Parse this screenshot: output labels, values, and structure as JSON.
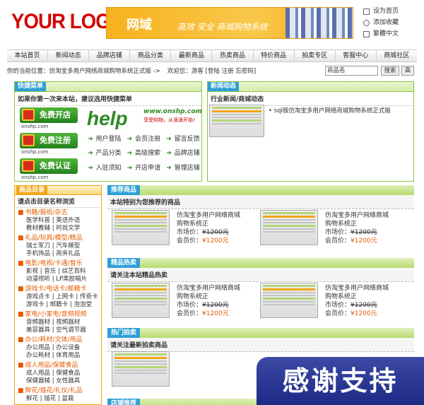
{
  "header": {
    "logo": "YOUR LOGO",
    "banner_title": "网域",
    "banner_slogan": "高效 安全 商城购物系统",
    "top_links": [
      "设为首页",
      "添加收藏",
      "繁體中文"
    ]
  },
  "nav": [
    "本站首页",
    "新闻动态",
    "品牌店铺",
    "商品分类",
    "最新商品",
    "热卖商品",
    "特价商品",
    "拍卖专区",
    "客服中心",
    "商城社区"
  ],
  "location": {
    "text": "你的当前位置：仿淘宝多用户网络商城购物系统正式版 ->",
    "welcome": "欢迎您：游客 [登陆 注册 忘密码]"
  },
  "search": {
    "value": "商品名",
    "button": "搜索",
    "button2": "高"
  },
  "quick": {
    "tab": "快捷菜单",
    "subtitle": "如果你第一次来本站，建议选用快捷菜单",
    "buttons": [
      "免费开店",
      "免费注册",
      "免费认证"
    ],
    "site": "onshp.com",
    "help": "help",
    "help_url": "www.onshp.com",
    "help_slogan": "享受购物，从滴滴开始!",
    "links": [
      [
        "用户登陆",
        "会员注册",
        "留言反馈"
      ],
      [
        "产品分类",
        "高级搜索",
        "品牌店铺"
      ],
      [
        "入驻须知",
        "开店申请",
        "管理店铺"
      ]
    ]
  },
  "news": {
    "tab": "新闻动态",
    "subtitle": "行业新闻/商城动态",
    "items": [
      "sql版仿淘宝多用户网络商城购物系统正式版"
    ]
  },
  "catalog": {
    "tab": "商品目录",
    "subtitle": "请点击目录名称浏览",
    "groups": [
      {
        "head": "书籍/报纸/杂志",
        "items": [
          "医学科普 | 英语外语",
          "教材教辅 | 时尚文学"
        ]
      },
      {
        "head": "礼品/玩具/模型/精品",
        "items": [
          "瑞士军刀 | 汽车模型",
          "手机饰品 | 商务礼品"
        ]
      },
      {
        "head": "电影/电视/卡通/音乐",
        "items": [
          "影视 | 音乐 | 综艺百科",
          "动漫视听 | LP黑胶唱片"
        ]
      },
      {
        "head": "游戏卡/电话卡/邮籍卡",
        "items": [
          "游戏点卡 | 上网卡 | 传奇卡",
          "游戏卡 | 邮籍卡 | 泡泡堂"
        ]
      },
      {
        "head": "家电/小家电/音频视频",
        "items": [
          "音频器材 | 视频器材",
          "美容器具 | 空气调节器"
        ]
      },
      {
        "head": "办公/耗材/文体/用品",
        "items": [
          "办公用品 | 办公设备",
          "办公耗材 | 体育用品"
        ]
      },
      {
        "head": "成人用品/保健食品",
        "items": [
          "成人用品 | 保健食品",
          "保健器械 | 女性器具"
        ]
      },
      {
        "head": "鲜花/插花/礼仪/礼品",
        "items": [
          "鲜花 | 插花 | 盆栽"
        ]
      }
    ]
  },
  "sections": [
    {
      "tab": "推荐商品",
      "subtitle": "本站特别为您推荐的商品"
    },
    {
      "tab": "精品热卖",
      "subtitle": "请关注本站精品热卖"
    },
    {
      "tab": "热门拍卖",
      "subtitle": "请关注最新拍卖商品"
    },
    {
      "tab": "店铺推荐"
    }
  ],
  "product": {
    "name": "仿淘宝多用户网络商城购物系统正",
    "market_label": "市场价：",
    "market_price": "¥1200元",
    "member_label": "会员价：",
    "member_price": "¥1200元"
  },
  "watermark": "感谢支持",
  "colors": {
    "logo": "#d40000",
    "accent_green": "#8cc63f",
    "tab_blue": "#2e9fd6",
    "orange": "#f3a516"
  }
}
